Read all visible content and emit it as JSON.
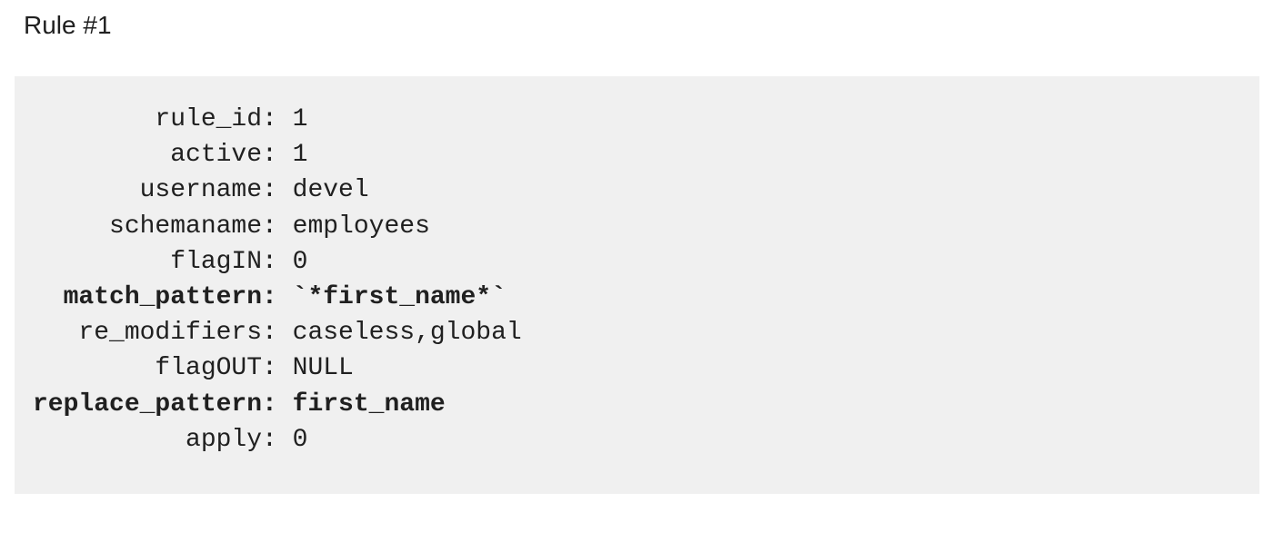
{
  "heading": "Rule #1",
  "code": {
    "lines": [
      {
        "label": "        rule_id:",
        "value": " 1",
        "bold": false
      },
      {
        "label": "         active:",
        "value": " 1",
        "bold": false
      },
      {
        "label": "       username:",
        "value": " devel",
        "bold": false
      },
      {
        "label": "     schemaname:",
        "value": " employees",
        "bold": false
      },
      {
        "label": "         flagIN:",
        "value": " 0",
        "bold": false
      },
      {
        "label": "  match_pattern:",
        "value": " `*first_name*`",
        "bold": true
      },
      {
        "label": "   re_modifiers:",
        "value": " caseless,global",
        "bold": false
      },
      {
        "label": "        flagOUT:",
        "value": " NULL",
        "bold": false
      },
      {
        "label": "replace_pattern:",
        "value": " first_name",
        "bold": true
      },
      {
        "label": "          apply:",
        "value": " 0",
        "bold": false
      }
    ]
  }
}
